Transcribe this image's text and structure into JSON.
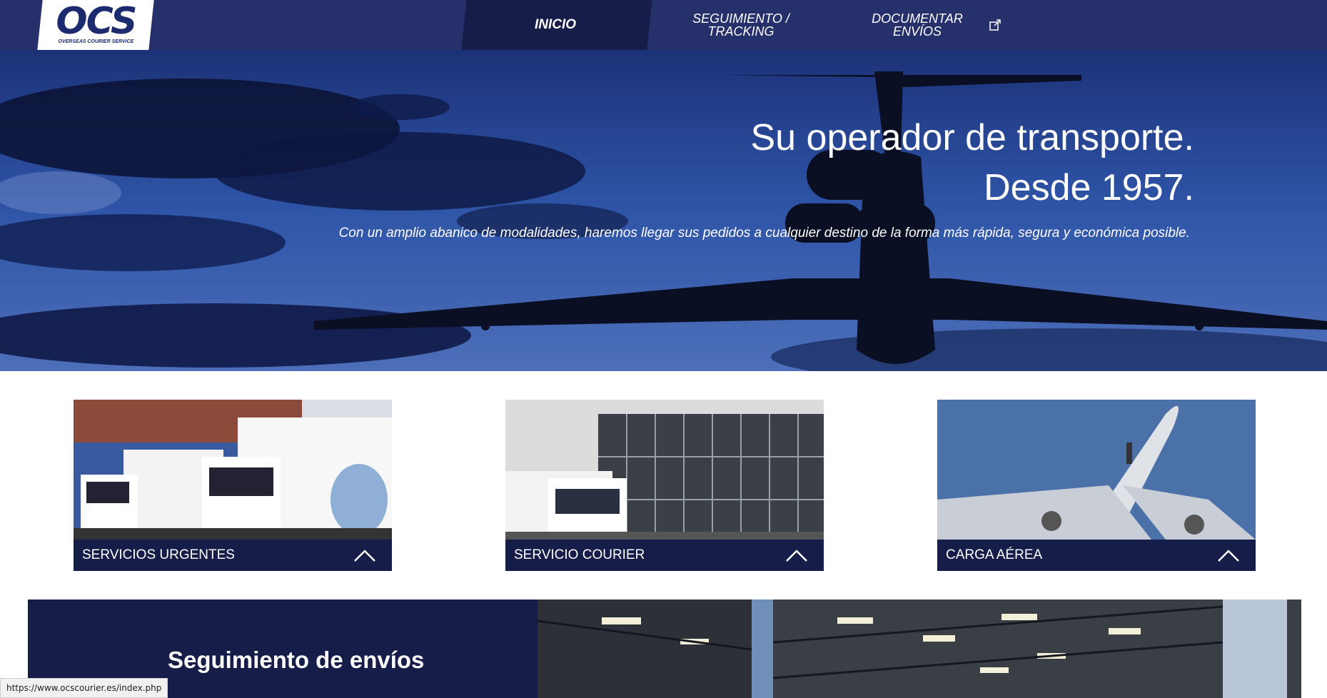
{
  "brand": {
    "logo_text": "OCS",
    "logo_subtext": "OVERSEAS COURIER SERVICE",
    "primary_color": "#26306a",
    "dark_color": "#161d49"
  },
  "nav": {
    "items": [
      {
        "label": "INICIO",
        "active": true
      },
      {
        "label": "SEGUIMIENTO / TRACKING",
        "active": false
      },
      {
        "label": "DOCUMENTAR ENVÍOS",
        "active": false,
        "icon": "external-link-icon"
      }
    ]
  },
  "hero": {
    "title_line1": "Su operador de transporte.",
    "title_line2": "Desde 1957.",
    "subtitle": "Con un amplio abanico de modalidades, haremos llegar sus pedidos a cualquier destino de la forma más rápida, segura y económica posible."
  },
  "services": [
    {
      "label": "SERVICIOS URGENTES",
      "icon": "chevron-up-icon"
    },
    {
      "label": "SERVICIO COURIER",
      "icon": "chevron-up-icon"
    },
    {
      "label": "CARGA AÉREA",
      "icon": "chevron-up-icon"
    }
  ],
  "tracking_section": {
    "title": "Seguimiento de envíos"
  },
  "status_bar": {
    "url": "https://www.ocscourier.es/index.php"
  }
}
